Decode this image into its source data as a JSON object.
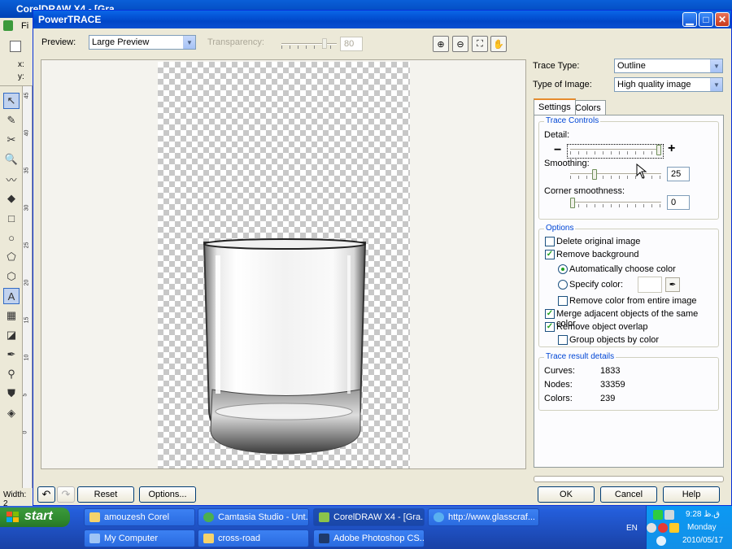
{
  "app": {
    "title": "CorelDRAW X4 - [Gra...",
    "menu_first": "Fi",
    "prop_x": "x:",
    "prop_y": "y:",
    "status_width": "Width: 2",
    "ruler_numbers": [
      "45",
      "40",
      "35",
      "30",
      "25",
      "20",
      "15",
      "10",
      "5",
      "0"
    ],
    "ruler_unit": "centimeters"
  },
  "dialog": {
    "title": "PowerTRACE",
    "preview_label": "Preview:",
    "preview_value": "Large Preview",
    "transparency_label": "Transparency:",
    "transparency_value": "80",
    "trace_type_label": "Trace Type:",
    "trace_type_value": "Outline",
    "image_type_label": "Type of Image:",
    "image_type_value": "High quality image",
    "tabs": [
      "Settings",
      "Colors"
    ],
    "trace_controls": {
      "title": "Trace Controls",
      "detail_label": "Detail:",
      "smoothing_label": "Smoothing:",
      "smoothing_value": "25",
      "corner_label": "Corner smoothness:",
      "corner_value": "0",
      "detail_level": 1.0,
      "smoothing_level": 0.25,
      "corner_level": 0.0
    },
    "options": {
      "title": "Options",
      "delete_original": "Delete original image",
      "remove_background": "Remove background",
      "auto_color": "Automatically choose color",
      "specify_color": "Specify color:",
      "remove_entire": "Remove color from entire image",
      "merge_adjacent": "Merge adjacent objects of the same color",
      "remove_overlap": "Remove object overlap",
      "group_by_color": "Group objects by color"
    },
    "results": {
      "title": "Trace result details",
      "curves_label": "Curves:",
      "curves_value": "1833",
      "nodes_label": "Nodes:",
      "nodes_value": "33359",
      "colors_label": "Colors:",
      "colors_value": "239"
    },
    "buttons": {
      "reset": "Reset",
      "options": "Options...",
      "ok": "OK",
      "cancel": "Cancel",
      "help": "Help"
    }
  },
  "taskbar": {
    "start": "start",
    "items": [
      "amouzesh Corel",
      "Camtasia Studio - Unt...",
      "CorelDRAW X4 - [Gra...",
      "http://www.glasscraf...",
      "My Computer",
      "cross-road",
      "Adobe Photoshop CS..."
    ],
    "lang": "EN",
    "time": "9:28 ق.ظ",
    "day": "Monday",
    "date": "2010/05/17"
  }
}
